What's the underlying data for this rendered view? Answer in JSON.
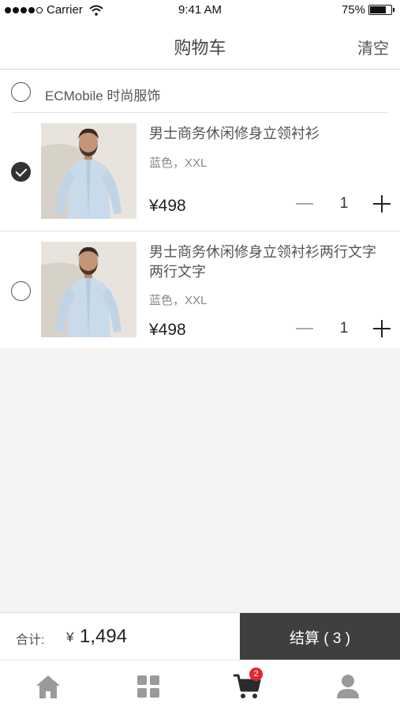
{
  "status_bar": {
    "carrier": "Carrier",
    "time": "9:41 AM",
    "battery": "75%",
    "battery_level": 0.75
  },
  "nav": {
    "title": "购物车",
    "clear_label": "清空"
  },
  "shop": {
    "name": "ECMobile 时尚服饰",
    "selected": false
  },
  "items": [
    {
      "title": "男士商务休闲修身立领衬衫",
      "spec": "蓝色，XXL",
      "price": "¥498",
      "quantity": "1",
      "selected": true
    },
    {
      "title": "男士商务休闲修身立领衬衫两行文字两行文字",
      "spec": "蓝色，XXL",
      "price": "¥498",
      "quantity": "1",
      "selected": false
    }
  ],
  "summary": {
    "total_label": "合计:",
    "currency": "¥",
    "total": "1,494",
    "checkout_label": "结算 ( 3 )"
  },
  "tabbar": {
    "tabs": [
      {
        "icon": "home-icon"
      },
      {
        "icon": "grid-icon"
      },
      {
        "icon": "cart-icon",
        "badge": "2"
      },
      {
        "icon": "user-icon"
      }
    ]
  },
  "colors": {
    "accent": "#3e3f41",
    "badge": "#e0262f",
    "background": "#f4f4f4"
  }
}
